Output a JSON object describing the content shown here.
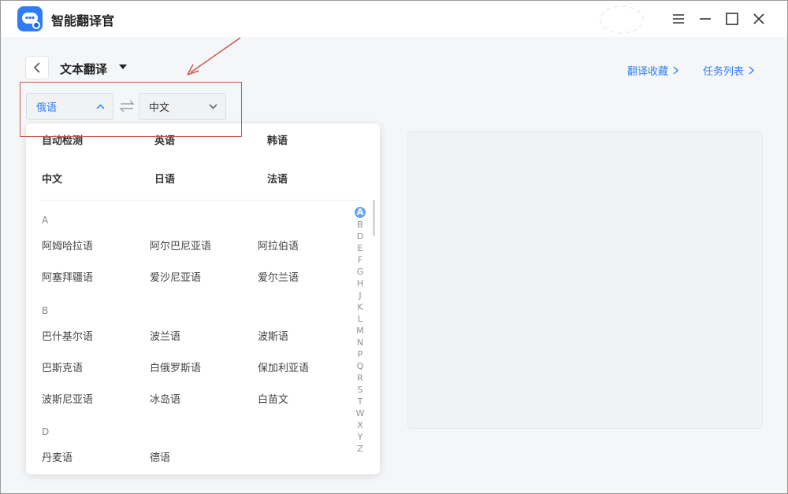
{
  "app": {
    "title": "智能翻译官"
  },
  "header": {
    "mode_title": "文本翻译",
    "favorites_link": "翻译收藏",
    "tasks_link": "任务列表"
  },
  "selectors": {
    "source": "俄语",
    "target": "中文"
  },
  "dropdown": {
    "common": [
      "自动检测",
      "英语",
      "韩语",
      "中文",
      "日语",
      "法语"
    ],
    "groups": [
      {
        "letter": "A",
        "items": [
          "阿姆哈拉语",
          "阿尔巴尼亚语",
          "阿拉伯语",
          "阿塞拜疆语",
          "爱沙尼亚语",
          "爱尔兰语"
        ]
      },
      {
        "letter": "B",
        "items": [
          "巴什基尔语",
          "波兰语",
          "波斯语",
          "巴斯克语",
          "白俄罗斯语",
          "保加利亚语",
          "波斯尼亚语",
          "冰岛语",
          "白苗文"
        ]
      },
      {
        "letter": "D",
        "items": [
          "丹麦语",
          "德语"
        ]
      }
    ],
    "alphabet": [
      "A",
      "B",
      "D",
      "E",
      "F",
      "G",
      "H",
      "J",
      "K",
      "L",
      "M",
      "N",
      "P",
      "Q",
      "R",
      "S",
      "T",
      "W",
      "X",
      "Y",
      "Z"
    ],
    "active_letter": "A"
  },
  "colors": {
    "accent": "#2d7ff9",
    "annotation": "#c8584e"
  },
  "icons": {
    "window": [
      "menu-icon",
      "minimize-icon",
      "maximize-icon",
      "close-icon"
    ]
  }
}
